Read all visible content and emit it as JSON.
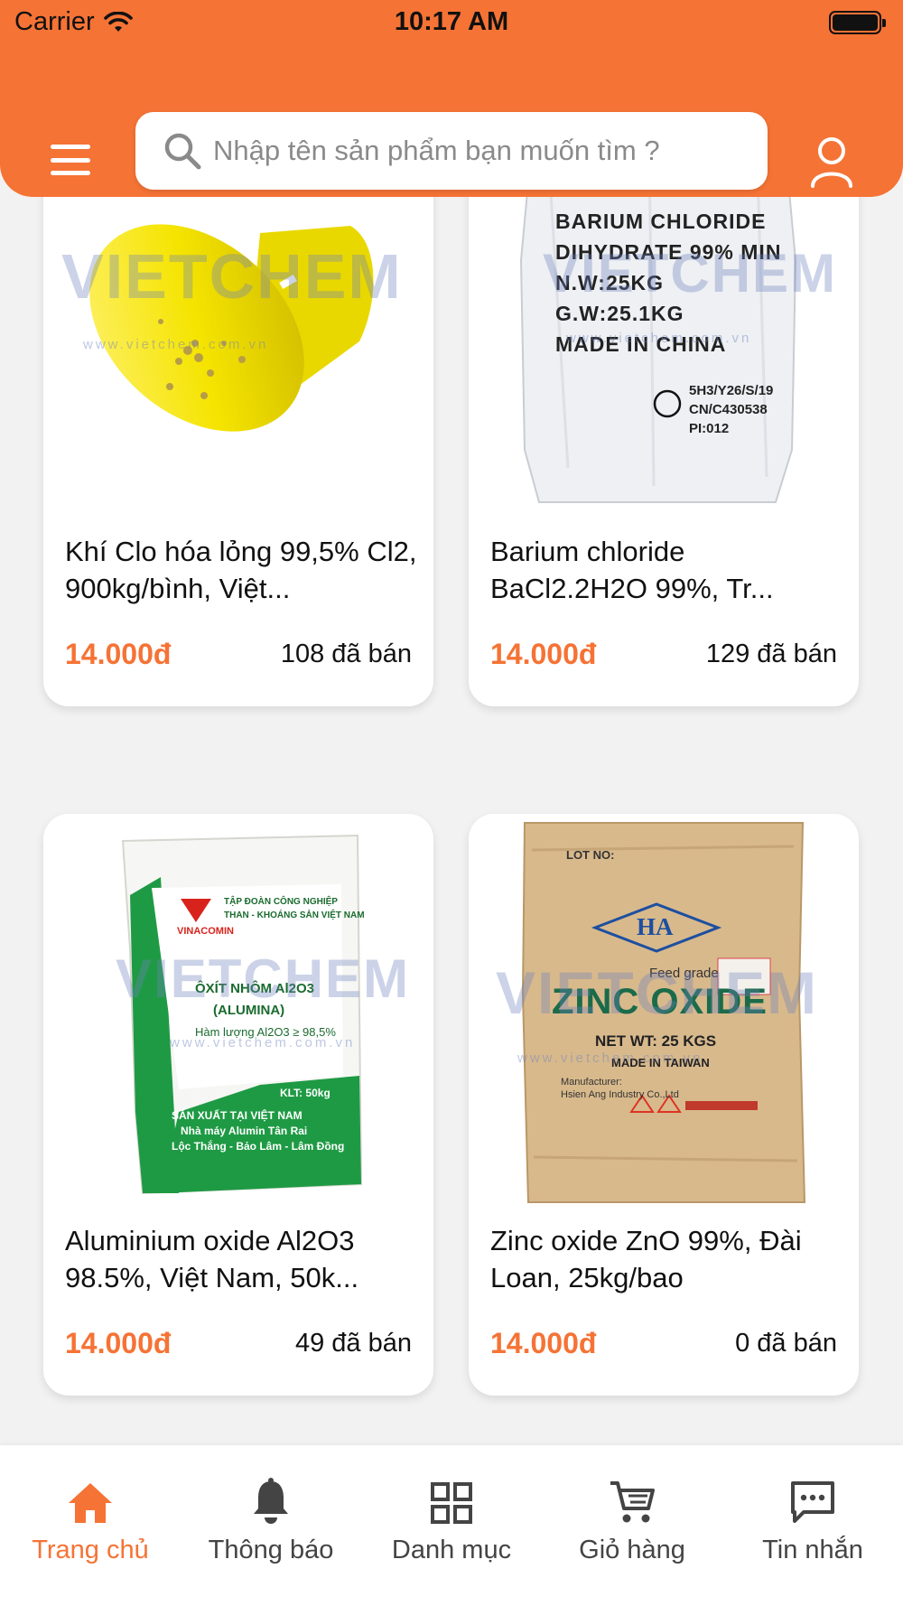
{
  "status_bar": {
    "carrier": "Carrier",
    "time": "10:17 AM"
  },
  "header": {
    "search_placeholder": "Nhập tên sản phẩm bạn muốn tìm ?",
    "icons": {
      "menu": "hamburger-menu-icon",
      "search": "search-icon",
      "user": "user-icon"
    }
  },
  "products": [
    {
      "name": "Khí Clo hóa lỏng 99,5% Cl2, 900kg/bình, Việt...",
      "price": "14.000đ",
      "sold": "108 đã bán",
      "image": "yellow-chlorine-cylinder"
    },
    {
      "name": "Barium chloride BaCl2.2H2O 99%, Tr...",
      "price": "14.000đ",
      "sold": "129 đã bán",
      "image": "white-sack-barium-chloride",
      "image_text": [
        "BARIUM CHLORIDE",
        "DIHYDRATE 99% MIN",
        "N.W:25KG",
        "G.W:25.1KG",
        "MADE IN CHINA",
        "5H3/Y26/S/19",
        "CN/C430538",
        "PI:012"
      ]
    },
    {
      "name": "Aluminium oxide Al2O3 98.5%, Việt Nam, 50k...",
      "price": "14.000đ",
      "sold": "49 đã bán",
      "image": "green-white-sack-alumina",
      "image_text": [
        "TẬP ĐOÀN CÔNG NGHIỆP",
        "THAN - KHOÁNG SẢN VIỆT NAM",
        "VINACOMIN",
        "ÔXÍT NHÔM Al2O3",
        "(ALUMINA)",
        "Hàm lượng Al2O3 ≥ 98,5%",
        "KLT: 50kg",
        "SẢN XUẤT TẠI VIỆT NAM",
        "Nhà máy Alumin Tân Rai",
        "Lộc Thắng - Bảo Lâm - Lâm Đồng"
      ]
    },
    {
      "name": "Zinc oxide ZnO 99%, Đài Loan, 25kg/bao",
      "price": "14.000đ",
      "sold": "0 đã bán",
      "image": "paper-bag-zinc-oxide",
      "image_text": [
        "LOT NO:",
        "HA",
        "Feed grade",
        "ZINC OXIDE",
        "NET WT: 25 KGS",
        "MADE IN TAIWAN",
        "Manufacturer:",
        "Hsien Ang Industry Co.,Ltd"
      ]
    }
  ],
  "watermark": {
    "brand": "VIETCHEM",
    "url": "www.vietchem.com.vn"
  },
  "bottom_nav": [
    {
      "label": "Trang chủ",
      "icon": "home-icon",
      "active": true
    },
    {
      "label": "Thông báo",
      "icon": "bell-icon",
      "active": false
    },
    {
      "label": "Danh mục",
      "icon": "grid-icon",
      "active": false
    },
    {
      "label": "Giỏ hàng",
      "icon": "cart-icon",
      "active": false
    },
    {
      "label": "Tin nhắn",
      "icon": "message-icon",
      "active": false
    }
  ],
  "colors": {
    "accent": "#f57335",
    "background": "#f2f2f2"
  }
}
